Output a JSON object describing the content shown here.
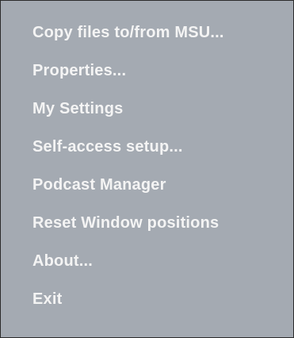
{
  "menu": {
    "items": [
      {
        "label": "Copy files to/from MSU..."
      },
      {
        "label": "Properties..."
      },
      {
        "label": "My Settings"
      },
      {
        "label": "Self-access setup..."
      },
      {
        "label": "Podcast Manager"
      },
      {
        "label": "Reset Window positions"
      },
      {
        "label": "About..."
      },
      {
        "label": "Exit"
      }
    ]
  },
  "colors": {
    "menu_background": "#a4aab2",
    "menu_text": "#f4f4f4",
    "menu_border": "#2b2b2b"
  }
}
